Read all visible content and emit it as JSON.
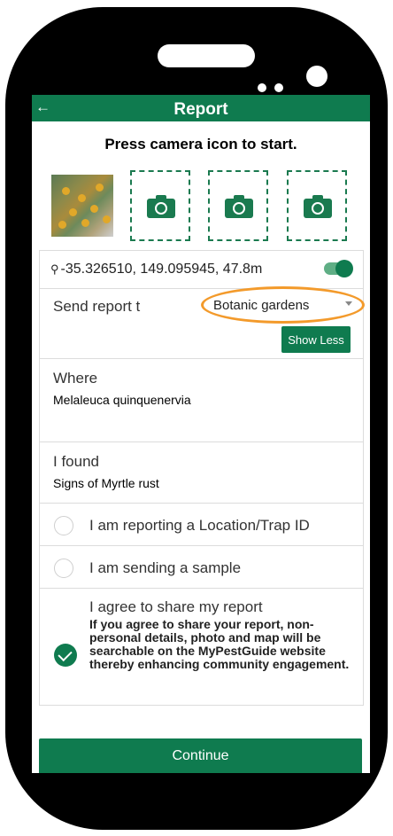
{
  "app_bar": {
    "title": "Report",
    "back_icon": "arrow-left-icon",
    "color": "#0f7b4f"
  },
  "instruction": "Press camera icon to start.",
  "photos": {
    "camera_slots": 3,
    "camera_icon": "camera-icon"
  },
  "location": {
    "coordinates": "-35.326510, 149.095945, 47.8m",
    "pin_icon": "map-pin-icon",
    "gps_on": true
  },
  "send_report": {
    "label": "Send report t",
    "selected": "Botanic gardens"
  },
  "show_less_label": "Show Less",
  "where": {
    "label": "Where",
    "value": "Melaleuca quinquenervia"
  },
  "found": {
    "label": "I found",
    "value": "Signs of Myrtle rust"
  },
  "options": [
    {
      "label": "I am reporting a Location/Trap ID",
      "checked": false
    },
    {
      "label": "I am sending a sample",
      "checked": false
    }
  ],
  "agree": {
    "title": "I agree to share my report",
    "body": "If you agree to share your report, non-personal details, photo and map will be searchable on the MyPestGuide website thereby enhancing community engagement.",
    "checked": true
  },
  "continue_label": "Continue",
  "highlight_color": "#f39a2b"
}
